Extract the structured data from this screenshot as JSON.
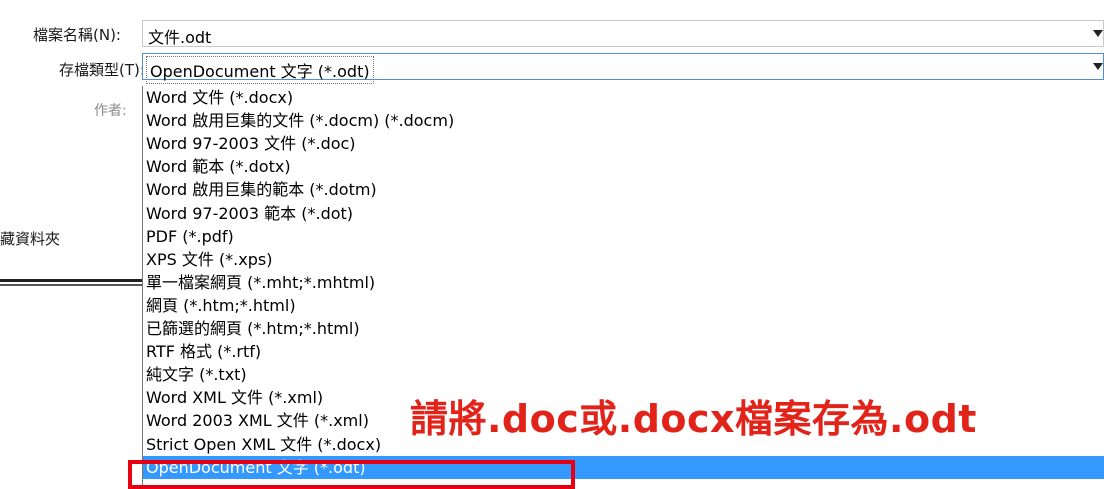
{
  "filename_label": "檔案名稱(N):",
  "filename_value": "文件.odt",
  "filetype_label": "存檔類型(T):",
  "filetype_value": "OpenDocument 文字 (*.odt)",
  "author_label": "作者:",
  "folder_label": "藏資料夾",
  "dropdown_options": [
    "Word 文件 (*.docx)",
    "Word 啟用巨集的文件 (*.docm) (*.docm)",
    "Word 97-2003 文件 (*.doc)",
    "Word 範本 (*.dotx)",
    "Word 啟用巨集的範本 (*.dotm)",
    "Word 97-2003 範本 (*.dot)",
    "PDF (*.pdf)",
    "XPS 文件 (*.xps)",
    "單一檔案網頁 (*.mht;*.mhtml)",
    "網頁 (*.htm;*.html)",
    "已篩選的網頁 (*.htm;*.html)",
    "RTF 格式 (*.rtf)",
    "純文字 (*.txt)",
    "Word XML 文件 (*.xml)",
    "Word 2003 XML 文件 (*.xml)",
    "Strict Open XML 文件 (*.docx)",
    "OpenDocument 文字 (*.odt)"
  ],
  "selected_option_index": 16,
  "annotation_text": "請將.doc或.docx檔案存為.odt",
  "colors": {
    "selection": "#3399ff",
    "highlight_box": "#e60012",
    "annotation": "#e2231a"
  }
}
